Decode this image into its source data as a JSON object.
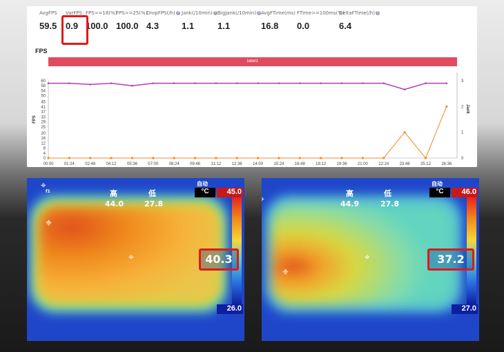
{
  "metrics": [
    {
      "label": "AvgFPS",
      "value": "59.5"
    },
    {
      "label": "VarFPS",
      "value": "0.9"
    },
    {
      "label": "FPS>=18(%)",
      "value": "100.0"
    },
    {
      "label": "FPS>=25(%)",
      "value": "100.0"
    },
    {
      "label": "DropFPS(/h)",
      "value": "4.3",
      "help": true
    },
    {
      "label": "Jank(/10min)",
      "value": "1.1",
      "help": true
    },
    {
      "label": "BigJank(/10min)",
      "value": "1.1",
      "help": true
    },
    {
      "label": "AvgFTime(ms)",
      "value": "16.8"
    },
    {
      "label": "FTime>=100ms(%)",
      "value": "0.0"
    },
    {
      "label": "DeltaFTime(/h)",
      "value": "6.4",
      "help": true
    }
  ],
  "chart": {
    "title": "FPS",
    "label_bar": "label1",
    "ylabel": "FPS",
    "y2label": "Jank"
  },
  "chart_data": {
    "type": "line",
    "x": [
      "00:00",
      "01:24",
      "02:48",
      "04:12",
      "05:36",
      "07:00",
      "08:24",
      "09:48",
      "11:12",
      "12:36",
      "14:00",
      "15:24",
      "16:48",
      "18:12",
      "19:36",
      "21:00",
      "22:24",
      "23:48",
      "25:12",
      "26:36"
    ],
    "yticks": [
      0,
      4,
      8,
      12,
      16,
      20,
      25,
      29,
      33,
      37,
      41,
      45,
      50,
      54,
      58,
      62
    ],
    "ylabels": [
      "0",
      "4",
      "8",
      "12",
      "16",
      "20",
      "25",
      "29",
      "33",
      "37",
      "41",
      "45",
      "50",
      "54",
      "58",
      "60"
    ],
    "ylim": [
      0,
      62
    ],
    "y2ticks": [
      "0",
      "1",
      "2",
      "3"
    ],
    "y2lim": [
      0,
      3
    ],
    "series": [
      {
        "values": [
          60,
          60,
          59,
          60,
          58,
          60,
          60,
          60,
          60,
          60,
          60,
          60,
          60,
          60,
          60,
          60,
          60,
          55,
          60,
          60
        ],
        "color": "#b03fb5"
      },
      {
        "values": [
          0,
          0,
          0,
          0,
          0,
          0,
          0,
          0,
          0,
          0,
          0,
          0,
          0,
          0,
          0,
          0,
          0,
          1,
          0,
          2
        ],
        "color": "#f08a24",
        "axis": "right"
      }
    ]
  },
  "thermal_left": {
    "high_label": "高",
    "low_label": "低",
    "high": "44.0",
    "low": "27.8",
    "mode": "自动",
    "unit": "°C",
    "max": "45.0",
    "min": "26.0",
    "center": "40.3",
    "spot_label": "f1"
  },
  "thermal_right": {
    "high_label": "高",
    "low_label": "低",
    "high": "44.9",
    "low": "27.8",
    "mode": "自动",
    "unit": "°C",
    "max": "46.0",
    "min": "27.0",
    "center": "37.2"
  }
}
